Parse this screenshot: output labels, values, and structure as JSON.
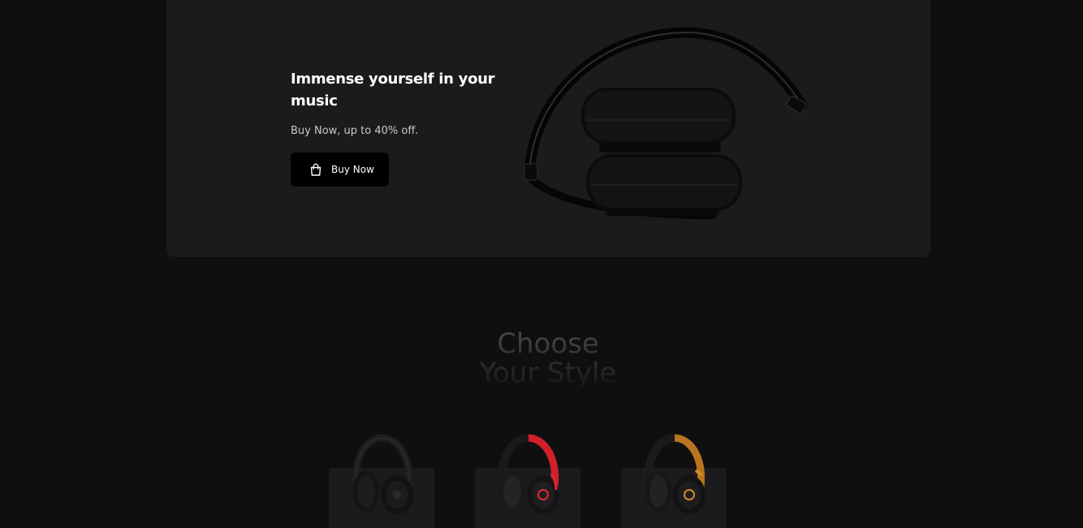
{
  "promo": {
    "title": "Immense yourself in your music",
    "subtitle": "Buy Now, up to 40% off.",
    "button_label": "Buy Now",
    "button_icon": "shopping-bag-icon",
    "image": "folded-headphones-image"
  },
  "styles_section": {
    "title_line1": "Choose",
    "title_line2": "Your Style",
    "items": [
      {
        "name": "black-headphones",
        "band_color": "#1e1e20",
        "accent_color": "#2a2a2c",
        "ear_color": "#151516"
      },
      {
        "name": "red-black-headphones",
        "band_color": "#d0202a",
        "accent_color": "#e32630",
        "ear_color": "#1a1a1c"
      },
      {
        "name": "gold-black-headphones",
        "band_color": "#b8741e",
        "accent_color": "#d08a2a",
        "ear_color": "#17171a"
      }
    ]
  },
  "colors": {
    "background": "#0f0f10",
    "card": "#1a1b1d",
    "button": "#000000",
    "title": "#ffffff"
  }
}
